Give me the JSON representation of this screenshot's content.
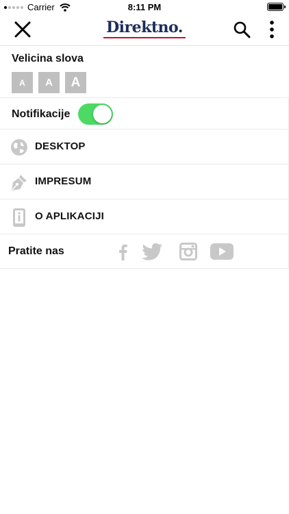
{
  "status_bar": {
    "carrier": "Carrier",
    "time": "8:11 PM"
  },
  "header": {
    "logo_text": "Direktno."
  },
  "font_size": {
    "label": "Velicina slova",
    "options": [
      "A",
      "A",
      "A"
    ]
  },
  "notifications": {
    "label": "Notifikacije",
    "enabled": true,
    "on_color": "#4cd964"
  },
  "menu": [
    {
      "label": "DESKTOP",
      "icon": "globe-icon"
    },
    {
      "label": "IMPRESUM",
      "icon": "pen-nib-icon"
    },
    {
      "label": "O APLIKACIJI",
      "icon": "info-phone-icon"
    }
  ],
  "follow": {
    "label": "Pratite nas",
    "networks": [
      "facebook-icon",
      "twitter-icon",
      "instagram-icon",
      "youtube-icon"
    ]
  },
  "colors": {
    "logo": "#1d2c5c",
    "logo_accent": "#c8102e",
    "icon_gray": "#c8c8c8",
    "button_gray": "#bfbfbf"
  }
}
